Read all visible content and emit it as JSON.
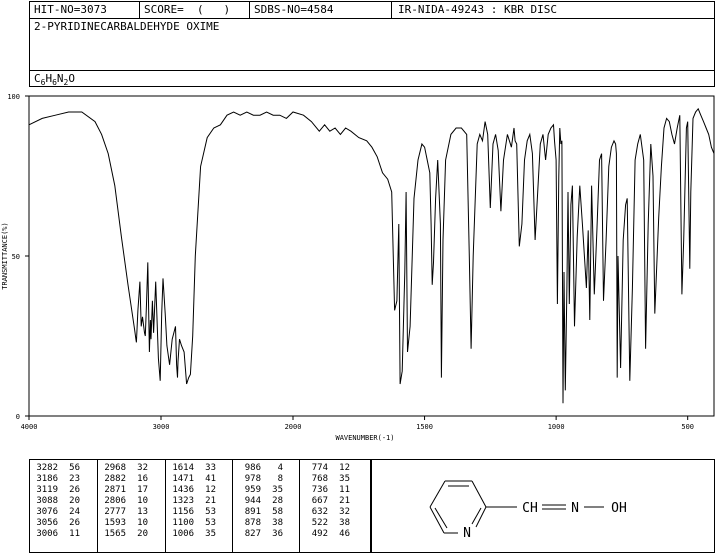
{
  "header": {
    "hit_no": "HIT-NO=3073",
    "score": "SCORE=  (   )",
    "sdbs_no": "SDBS-NO=4584",
    "ir_source": "IR-NIDA-49243 : KBR DISC",
    "compound_name": "2-PYRIDINECARBALDEHYDE OXIME",
    "formula": "C6H6N2O"
  },
  "chart_data": {
    "type": "line",
    "xlabel": "WAVENUMBER(-1)",
    "ylabel": "TRANSMITTANCE(%)",
    "xlim": [
      4000,
      400
    ],
    "ylim": [
      0,
      100
    ],
    "x_ticks": [
      "4000",
      "3000",
      "2000",
      "1500",
      "1000",
      "500"
    ],
    "y_ticks": [
      "100",
      "50",
      "0"
    ],
    "grid": false,
    "series": [
      {
        "color": "#000000",
        "x": [
          4000,
          3900,
          3800,
          3700,
          3600,
          3500,
          3450,
          3400,
          3350,
          3300,
          3250,
          3200,
          3190,
          3186,
          3175,
          3160,
          3150,
          3140,
          3125,
          3119,
          3110,
          3100,
          3088,
          3080,
          3076,
          3065,
          3056,
          3040,
          3020,
          3006,
          2995,
          2985,
          2968,
          2955,
          2935,
          2915,
          2890,
          2882,
          2875,
          2871,
          2860,
          2845,
          2825,
          2806,
          2790,
          2777,
          2760,
          2740,
          2700,
          2650,
          2600,
          2550,
          2500,
          2450,
          2400,
          2350,
          2300,
          2250,
          2200,
          2150,
          2100,
          2050,
          2000,
          1960,
          1930,
          1900,
          1880,
          1860,
          1840,
          1820,
          1800,
          1780,
          1750,
          1720,
          1700,
          1680,
          1660,
          1640,
          1625,
          1614,
          1605,
          1598,
          1593,
          1585,
          1575,
          1570,
          1565,
          1555,
          1540,
          1525,
          1510,
          1500,
          1490,
          1480,
          1475,
          1471,
          1466,
          1458,
          1450,
          1440,
          1436,
          1430,
          1420,
          1400,
          1380,
          1360,
          1340,
          1330,
          1323,
          1315,
          1300,
          1290,
          1280,
          1270,
          1260,
          1250,
          1240,
          1230,
          1220,
          1210,
          1200,
          1185,
          1170,
          1160,
          1156,
          1150,
          1140,
          1130,
          1120,
          1110,
          1100,
          1090,
          1080,
          1070,
          1060,
          1050,
          1040,
          1030,
          1020,
          1010,
          1006,
          1000,
          995,
          990,
          986,
          982,
          978,
          974,
          970,
          965,
          959,
          955,
          950,
          944,
          938,
          930,
          920,
          910,
          900,
          891,
          885,
          878,
          872,
          865,
          855,
          845,
          835,
          827,
          820,
          810,
          800,
          790,
          780,
          774,
          771,
          768,
          765,
          755,
          745,
          736,
          730,
          720,
          710,
          700,
          690,
          680,
          667,
          660,
          650,
          640,
          632,
          625,
          610,
          600,
          590,
          580,
          570,
          560,
          550,
          540,
          530,
          522,
          515,
          505,
          500,
          492,
          488,
          480,
          470,
          460,
          450,
          440,
          430,
          420,
          410,
          400
        ],
        "values": [
          91,
          93,
          94,
          95,
          95,
          92,
          88,
          82,
          72,
          56,
          41,
          27,
          24,
          23,
          33,
          42,
          28,
          31,
          26,
          25,
          35,
          48,
          20,
          30,
          24,
          36,
          26,
          42,
          18,
          11,
          32,
          43,
          32,
          22,
          16,
          24,
          28,
          16,
          12,
          17,
          24,
          22,
          20,
          10,
          12,
          13,
          25,
          50,
          78,
          87,
          90,
          91,
          94,
          95,
          94,
          95,
          94,
          94,
          95,
          94,
          94,
          93,
          95,
          94,
          92,
          89,
          91,
          89,
          90,
          88,
          90,
          89,
          87,
          86,
          84,
          81,
          76,
          74,
          70,
          33,
          36,
          60,
          10,
          14,
          45,
          70,
          20,
          28,
          68,
          80,
          85,
          84,
          80,
          76,
          60,
          41,
          48,
          68,
          80,
          60,
          12,
          55,
          80,
          88,
          90,
          90,
          88,
          50,
          21,
          50,
          85,
          88,
          86,
          92,
          88,
          65,
          85,
          88,
          83,
          64,
          80,
          88,
          84,
          90,
          86,
          85,
          53,
          60,
          80,
          86,
          88,
          82,
          55,
          70,
          85,
          88,
          80,
          88,
          90,
          91,
          86,
          80,
          35,
          75,
          90,
          85,
          86,
          4,
          45,
          8,
          40,
          70,
          35,
          66,
          72,
          28,
          56,
          72,
          60,
          48,
          40,
          58,
          30,
          72,
          38,
          58,
          80,
          82,
          36,
          55,
          78,
          84,
          86,
          85,
          82,
          12,
          50,
          15,
          55,
          66,
          68,
          11,
          40,
          80,
          85,
          88,
          80,
          21,
          60,
          85,
          75,
          32,
          62,
          78,
          90,
          93,
          92,
          88,
          85,
          90,
          94,
          38,
          55,
          90,
          92,
          46,
          70,
          93,
          95,
          96,
          94,
          92,
          90,
          88,
          84,
          82
        ]
      }
    ],
    "peak_table": {
      "columns": [
        [
          [
            "3282",
            "56"
          ],
          [
            "3186",
            "23"
          ],
          [
            "3119",
            "26"
          ],
          [
            "3088",
            "20"
          ],
          [
            "3076",
            "24"
          ],
          [
            "3056",
            "26"
          ],
          [
            "3006",
            "11"
          ]
        ],
        [
          [
            "2968",
            "32"
          ],
          [
            "2882",
            "16"
          ],
          [
            "2871",
            "17"
          ],
          [
            "2806",
            "10"
          ],
          [
            "2777",
            "13"
          ],
          [
            "1593",
            "10"
          ],
          [
            "1565",
            "20"
          ]
        ],
        [
          [
            "1614",
            "33"
          ],
          [
            "1471",
            "41"
          ],
          [
            "1436",
            "12"
          ],
          [
            "1323",
            "21"
          ],
          [
            "1156",
            "53"
          ],
          [
            "1100",
            "53"
          ],
          [
            "1006",
            "35"
          ]
        ],
        [
          [
            "986",
            "4"
          ],
          [
            "978",
            "8"
          ],
          [
            "959",
            "35"
          ],
          [
            "944",
            "28"
          ],
          [
            "891",
            "58"
          ],
          [
            "878",
            "38"
          ],
          [
            "827",
            "36"
          ]
        ],
        [
          [
            "774",
            "12"
          ],
          [
            "768",
            "35"
          ],
          [
            "736",
            "11"
          ],
          [
            "667",
            "21"
          ],
          [
            "632",
            "32"
          ],
          [
            "522",
            "38"
          ],
          [
            "492",
            "46"
          ]
        ]
      ]
    }
  },
  "structure": {
    "atom_n": "N",
    "link": "CH",
    "oxime_n": "N",
    "oh": "OH"
  }
}
